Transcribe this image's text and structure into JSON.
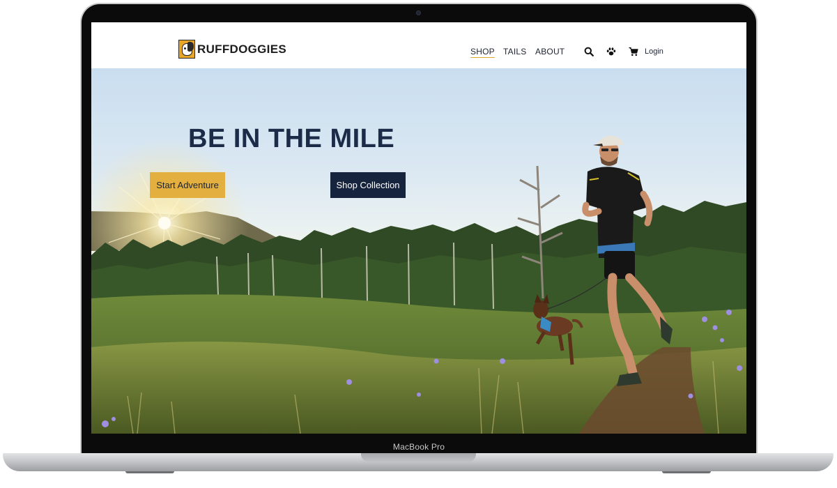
{
  "device": {
    "label": "MacBook Pro"
  },
  "site": {
    "logo_text": "RUFFDOGGIES",
    "nav": {
      "shop": "SHOP",
      "tails": "TAILS",
      "about": "ABOUT"
    },
    "icons": [
      "search-icon",
      "paw-icon",
      "cart-icon"
    ],
    "login_label": "Login"
  },
  "hero": {
    "title": "BE IN THE MILE",
    "start_button": "Start Adventure",
    "shop_button": "Shop Collection"
  },
  "colors": {
    "brand_navy": "#17243d",
    "brand_gold": "#e3b040",
    "nav_underline": "#e2a72b"
  }
}
